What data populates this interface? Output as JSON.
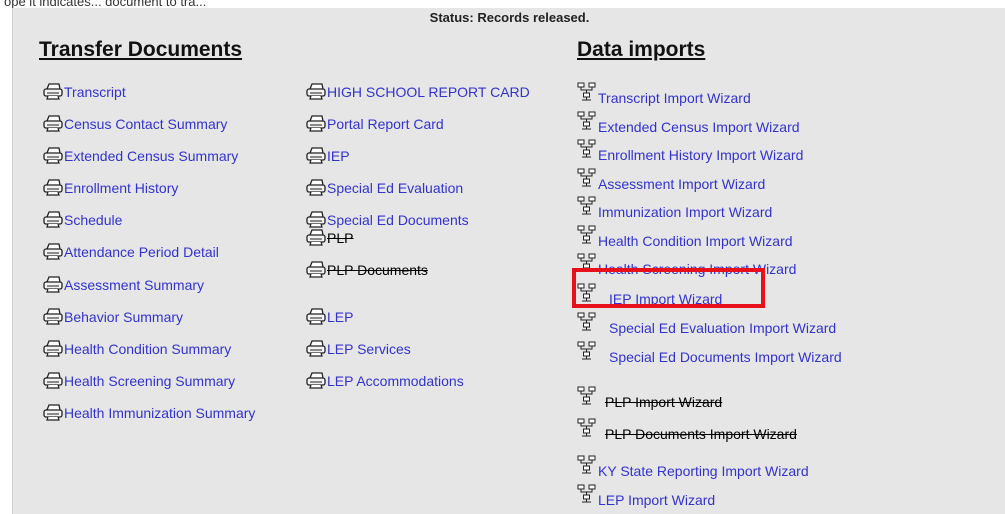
{
  "top_text": "ope it indicates... document to tra...",
  "status": "Status: Records released.",
  "transfer": {
    "heading": "Transfer Documents",
    "col1": [
      "Transcript",
      "Census Contact Summary",
      "Extended Census Summary",
      "Enrollment History",
      "Schedule",
      "Attendance Period Detail",
      "Assessment Summary",
      "Behavior Summary",
      "Health Condition Summary",
      "Health Screening Summary",
      "Health Immunization Summary"
    ],
    "col2": [
      "HIGH SCHOOL REPORT CARD",
      "Portal Report Card",
      "IEP",
      "Special Ed Evaluation",
      "Special Ed Documents",
      "PLP",
      "PLP Documents",
      "LEP",
      "LEP Services",
      "LEP Accommodations"
    ]
  },
  "imports": {
    "heading": "Data imports",
    "items": [
      "Transcript Import Wizard",
      "Extended Census Import Wizard",
      "Enrollment History Import Wizard",
      "Assessment Import Wizard",
      "Immunization Import Wizard",
      "Health Condition Import Wizard",
      "Health Screening Import Wizard",
      "IEP Import Wizard",
      "Special Ed Evaluation Import Wizard",
      "Special Ed Documents Import Wizard",
      "PLP Import Wizard",
      "PLP Documents Import Wizard",
      "KY State Reporting Import Wizard",
      "LEP Import Wizard"
    ]
  },
  "icons": {
    "print": "printer-icon",
    "import": "network-tree-icon"
  },
  "colors": {
    "link": "#3333cc",
    "panel": "#e6e6e6",
    "highlight": "#e8101a"
  }
}
